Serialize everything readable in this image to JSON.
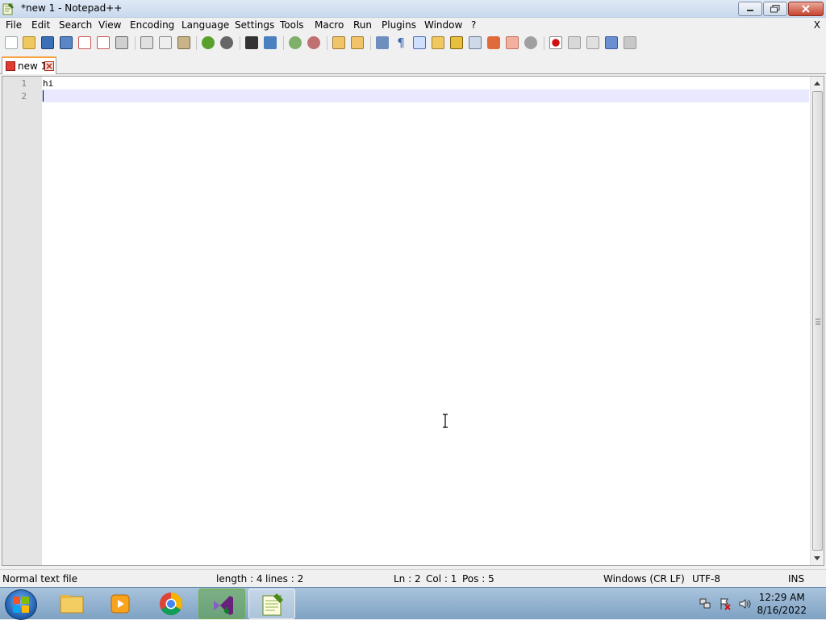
{
  "window": {
    "title": "*new 1 - Notepad++",
    "close_glyph": "X"
  },
  "menu": {
    "items": [
      {
        "label": "File"
      },
      {
        "label": "Edit"
      },
      {
        "label": "Search"
      },
      {
        "label": "View"
      },
      {
        "label": "Encoding"
      },
      {
        "label": "Language"
      },
      {
        "label": "Settings"
      },
      {
        "label": "Tools"
      },
      {
        "label": "Macro"
      },
      {
        "label": "Run"
      },
      {
        "label": "Plugins"
      },
      {
        "label": "Window"
      },
      {
        "label": "?"
      }
    ]
  },
  "toolbar": {
    "icons": [
      "new-file-icon",
      "open-file-icon",
      "save-icon",
      "save-all-icon",
      "close-icon",
      "close-all-icon",
      "print-icon",
      "cut-icon",
      "copy-icon",
      "paste-icon",
      "undo-icon",
      "redo-icon",
      "find-icon",
      "replace-icon",
      "zoom-in-icon",
      "zoom-out-icon",
      "sync-vertical-icon",
      "sync-horizontal-icon",
      "word-wrap-icon",
      "show-all-chars-icon",
      "indent-guide-icon",
      "user-define-lang-icon",
      "doc-map-icon",
      "function-list-icon",
      "folder-workspace-icon",
      "monitoring-icon",
      "record-macro-icon",
      "start-record-icon",
      "stop-record-icon",
      "playback-icon",
      "run-multiple-icon",
      "save-macro-icon"
    ]
  },
  "tabs": [
    {
      "label": "new 1"
    }
  ],
  "editor": {
    "line_numbers": [
      "1",
      "2"
    ],
    "lines": [
      "hi",
      ""
    ],
    "current_line": 2
  },
  "status": {
    "file_type": "Normal text file",
    "length": "length : 4",
    "lines": "lines : 2",
    "ln": "Ln : 2",
    "col": "Col : 1",
    "pos": "Pos : 5",
    "eol": "Windows (CR LF)",
    "encoding": "UTF-8",
    "mode": "INS"
  },
  "taskbar": {
    "apps": [
      "file-explorer-icon",
      "media-player-icon",
      "chrome-icon",
      "visual-studio-installer-icon",
      "notepad-plus-plus-icon"
    ],
    "active": "notepad-plus-plus-icon",
    "clock_time": "12:29 AM",
    "clock_date": "8/16/2022"
  }
}
